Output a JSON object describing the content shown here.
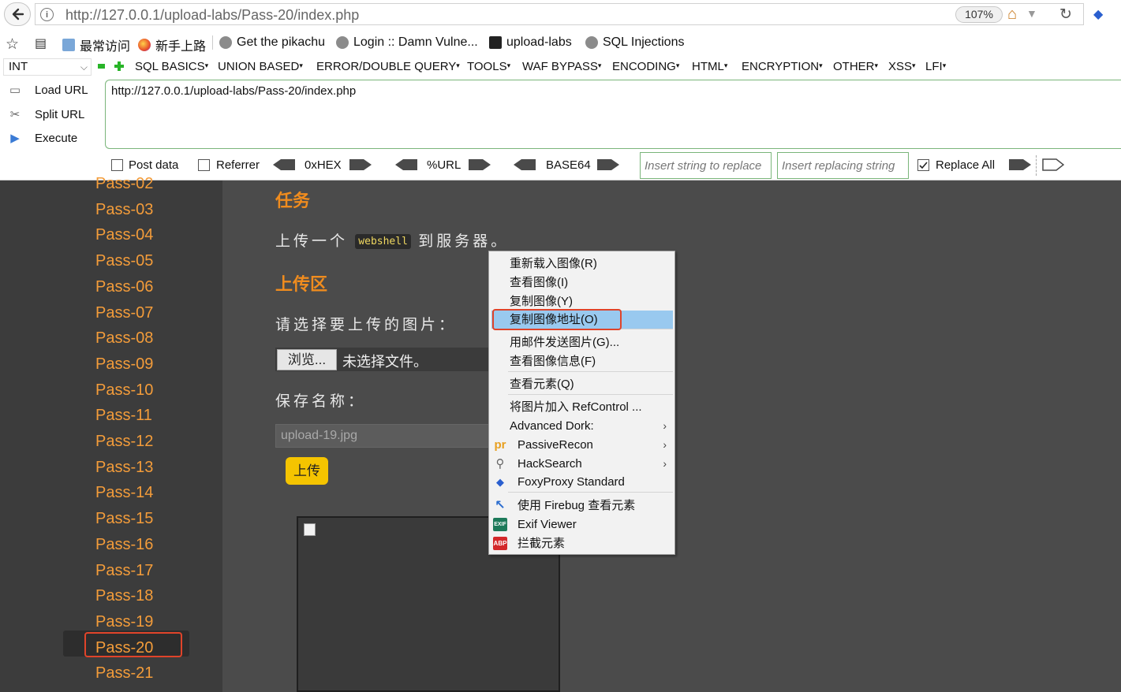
{
  "browser": {
    "url": "http://127.0.0.1/upload-labs/Pass-20/index.php",
    "zoom": "107%",
    "bookmarks": [
      {
        "label": "最常访问",
        "icon": "folder-icon"
      },
      {
        "label": "新手上路",
        "icon": "firefox-icon"
      },
      {
        "label": "Get the pikachu",
        "icon": "globe-icon"
      },
      {
        "label": "Login :: Damn Vulne...",
        "icon": "globe-icon"
      },
      {
        "label": "upload-labs",
        "icon": "folder-dark-icon"
      },
      {
        "label": "SQL Injections",
        "icon": "globe-icon"
      }
    ]
  },
  "hackbar": {
    "select_value": "INT",
    "menus": [
      "SQL BASICS",
      "UNION BASED",
      "ERROR/DOUBLE QUERY",
      "TOOLS",
      "WAF BYPASS",
      "ENCODING",
      "HTML",
      "ENCRYPTION",
      "OTHER",
      "XSS",
      "LFI"
    ],
    "load_url": "Load URL",
    "split_url": "Split URL",
    "execute": "Execute",
    "url_value": "http://127.0.0.1/upload-labs/Pass-20/index.php",
    "post_data": "Post data",
    "referrer": "Referrer",
    "hex": "0xHEX",
    "url_enc": "%URL",
    "base64": "BASE64",
    "insert_placeholder": "Insert string to replace",
    "replacing_placeholder": "Insert replacing string",
    "replace_all": "Replace All"
  },
  "sidebar": {
    "items": [
      "Pass-02",
      "Pass-03",
      "Pass-04",
      "Pass-05",
      "Pass-06",
      "Pass-07",
      "Pass-08",
      "Pass-09",
      "Pass-10",
      "Pass-11",
      "Pass-12",
      "Pass-13",
      "Pass-14",
      "Pass-15",
      "Pass-16",
      "Pass-17",
      "Pass-18",
      "Pass-19",
      "Pass-20",
      "Pass-21"
    ],
    "selected": "Pass-20"
  },
  "main": {
    "task_heading": "任务",
    "task_text_before": "上传一个",
    "task_code": "webshell",
    "task_text_after": "到服务器。",
    "upload_heading": "上传区",
    "choose_label": "请选择要上传的图片：",
    "browse_button": "浏览...",
    "no_file": "未选择文件。",
    "save_label": "保存名称：",
    "save_value": "upload-19.jpg",
    "upload_button": "上传"
  },
  "context_menu": {
    "items": [
      {
        "label": "重新载入图像(R)"
      },
      {
        "label": "查看图像(I)"
      },
      {
        "label": "复制图像(Y)"
      },
      {
        "label": "复制图像地址(O)",
        "highlighted": true
      },
      {
        "label": "用邮件发送图片(G)..."
      },
      {
        "label": "查看图像信息(F)"
      },
      {
        "label": "查看元素(Q)"
      },
      {
        "label": "将图片加入 RefControl ..."
      },
      {
        "label": "Advanced Dork:",
        "submenu": true
      },
      {
        "label": "PassiveRecon",
        "submenu": true,
        "icon": "pr-icon"
      },
      {
        "label": "HackSearch",
        "submenu": true,
        "icon": "magnifier-icon"
      },
      {
        "label": "FoxyProxy Standard",
        "icon": "fox-icon"
      },
      {
        "label": "使用 Firebug 查看元素",
        "icon": "firebug-icon"
      },
      {
        "label": "Exif Viewer",
        "icon": "exif-icon"
      },
      {
        "label": "拦截元素",
        "icon": "abp-icon"
      }
    ]
  },
  "colors": {
    "accent_orange": "#f08c1e",
    "highlight_red": "#e0442a",
    "menu_highlight": "#99c9ef",
    "upload_yellow": "#f5c400"
  }
}
